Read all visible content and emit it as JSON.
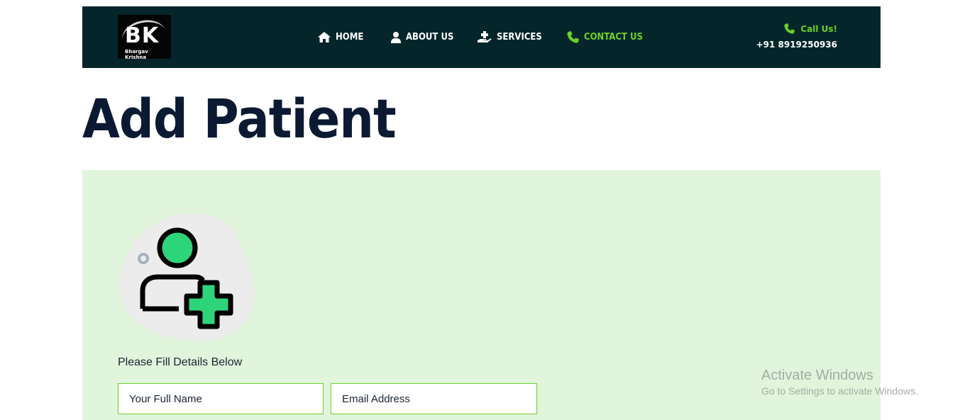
{
  "logo": {
    "letters": "BK",
    "subtitle": "Bhargav Krishna"
  },
  "nav": {
    "items": [
      {
        "label": "HOME",
        "icon": "home-icon"
      },
      {
        "label": "ABOUT US",
        "icon": "user-icon"
      },
      {
        "label": "SERVICES",
        "icon": "hand-medical-icon"
      },
      {
        "label": "CONTACT US",
        "icon": "phone-icon",
        "active": true
      }
    ]
  },
  "contact": {
    "label": "Call Us!",
    "number": "+91 8919250936",
    "icon": "phone-icon"
  },
  "page": {
    "title": "Add Patient"
  },
  "form": {
    "illustration_icon": "add-user-icon",
    "hint": "Please Fill Details Below",
    "name_placeholder": "Your Full Name",
    "email_placeholder": "Email Address"
  },
  "watermark": {
    "title": "Activate Windows",
    "subtitle": "Go to Settings to activate Windows."
  },
  "colors": {
    "header_bg": "#04262b",
    "accent": "#6bd12a",
    "title": "#0b1a33",
    "panel_bg": "#e1f4dc",
    "icon_green": "#2ed47a"
  }
}
